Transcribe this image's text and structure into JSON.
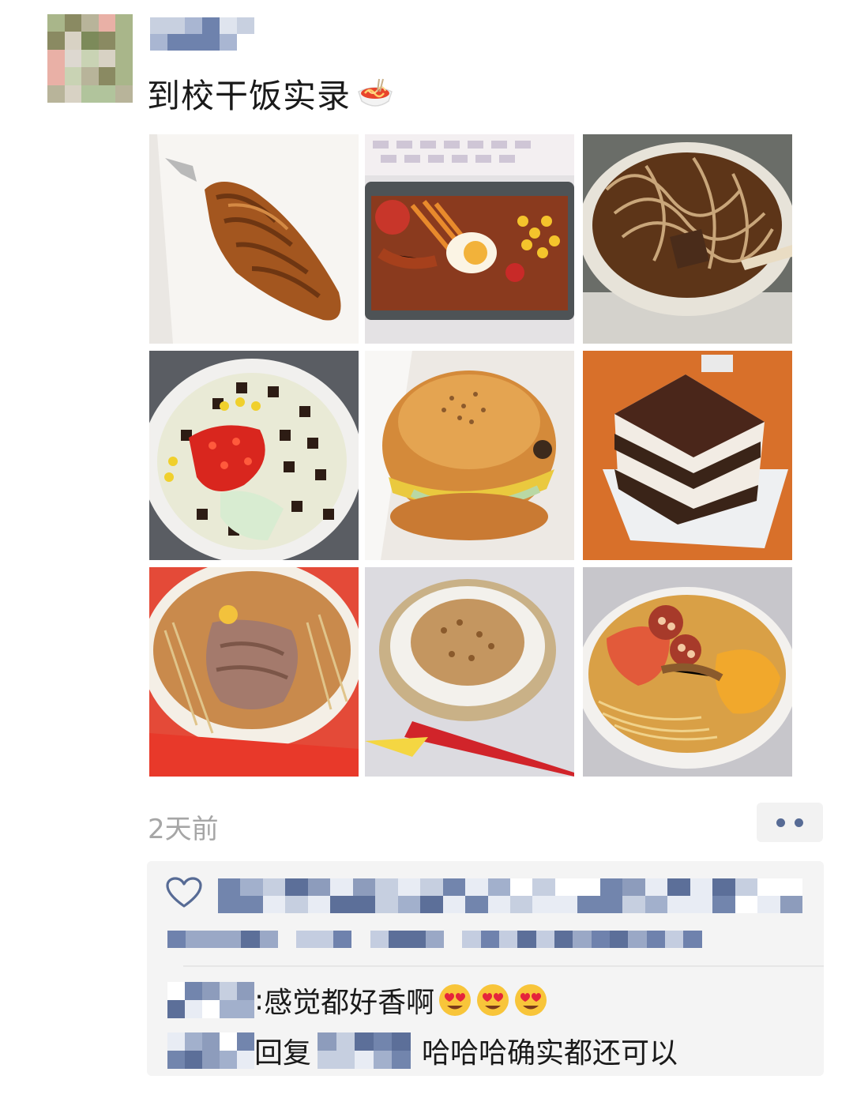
{
  "post": {
    "text": "到校干饭实录",
    "text_emoji": "spaghetti-emoji",
    "time": "2天前"
  },
  "photos": [
    "croissant-photo",
    "bento-box-photo",
    "noodle-soup-photo",
    "rice-bowl-photo",
    "burger-photo",
    "tiramisu-cake-photo",
    "spicy-noodle-bowl-photo",
    "rice-with-topping-photo",
    "noodles-with-lotus-photo"
  ],
  "comments": [
    {
      "text": "感觉都好香啊",
      "emojis": [
        "heart-eyes-emoji",
        "heart-eyes-emoji",
        "heart-eyes-emoji"
      ]
    },
    {
      "reply_label": "回复",
      "text": "哈哈哈确实都还可以"
    }
  ],
  "colors": {
    "link_blue": "#576b95",
    "time_gray": "#a6a6a6",
    "panel_bg": "#f4f4f4"
  }
}
